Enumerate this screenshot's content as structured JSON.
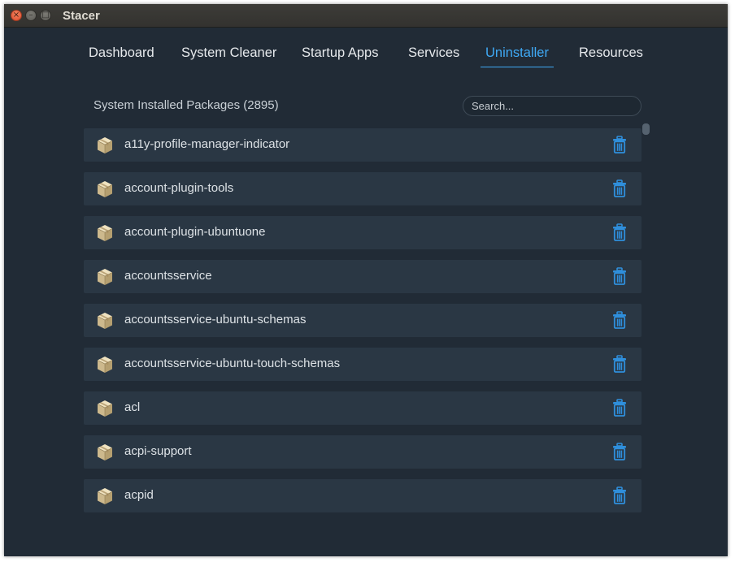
{
  "window": {
    "title": "Stacer"
  },
  "tabs": [
    {
      "label": "Dashboard",
      "active": false
    },
    {
      "label": "System Cleaner",
      "active": false
    },
    {
      "label": "Startup Apps",
      "active": false
    },
    {
      "label": "Services",
      "active": false
    },
    {
      "label": "Uninstaller",
      "active": true
    },
    {
      "label": "Resources",
      "active": false
    }
  ],
  "uninstaller": {
    "header": "System Installed Packages (2895)",
    "search_placeholder": "Search...",
    "packages": [
      "a11y-profile-manager-indicator",
      "account-plugin-tools",
      "account-plugin-ubuntuone",
      "accountsservice",
      "accountsservice-ubuntu-schemas",
      "accountsservice-ubuntu-touch-schemas",
      "acl",
      "acpi-support",
      "acpid"
    ]
  },
  "icons": {
    "package": "package-box-icon",
    "delete": "trash-icon",
    "close": "close-icon",
    "minimize": "minimize-icon",
    "maximize": "maximize-icon"
  },
  "colors": {
    "accent": "#3fa9f5",
    "background": "#212b36",
    "row": "#2a3744",
    "trash": "#2f8fdc"
  }
}
